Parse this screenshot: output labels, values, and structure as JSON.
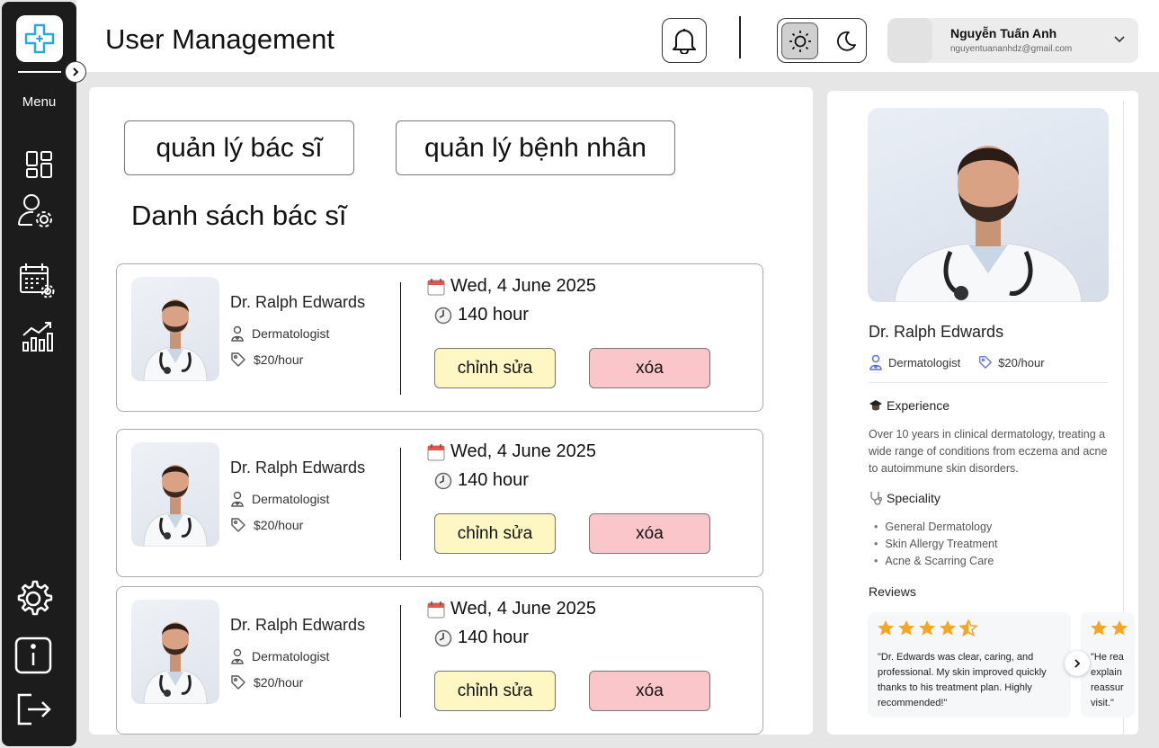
{
  "sidebar": {
    "menu_label": "Menu",
    "icons": [
      "dashboard-icon",
      "user-settings-icon",
      "calendar-settings-icon",
      "analytics-icon",
      "settings-icon",
      "info-icon",
      "logout-icon"
    ]
  },
  "header": {
    "title": "User Management",
    "user_name": "Nguyễn Tuấn Anh",
    "user_email": "nguyentuananhdz@gmail.com"
  },
  "tabs": [
    {
      "label": "quản lý bác sĩ"
    },
    {
      "label": "quản lý bệnh nhân"
    }
  ],
  "list": {
    "title": "Danh sách bác sĩ",
    "cards": [
      {
        "name": "Dr. Ralph Edwards",
        "specialty": "Dermatologist",
        "rate": "$20/hour",
        "date": "Wed, 4 June 2025",
        "hours": "140 hour",
        "edit_label": "chỉnh sửa",
        "delete_label": "xóa"
      },
      {
        "name": "Dr. Ralph Edwards",
        "specialty": "Dermatologist",
        "rate": "$20/hour",
        "date": "Wed, 4 June 2025",
        "hours": "140 hour",
        "edit_label": "chỉnh sửa",
        "delete_label": "xóa"
      },
      {
        "name": "Dr. Ralph Edwards",
        "specialty": "Dermatologist",
        "rate": "$20/hour",
        "date": "Wed, 4 June 2025",
        "hours": "140 hour",
        "edit_label": "chỉnh sửa",
        "delete_label": "xóa"
      }
    ]
  },
  "detail": {
    "name": "Dr. Ralph Edwards",
    "specialty": "Dermatologist",
    "rate": "$20/hour",
    "experience_title": "Experience",
    "experience_text": "Over 10 years in clinical dermatology, treating a wide range of conditions from eczema and acne to autoimmune skin disorders.",
    "speciality_title": "Speciality",
    "speciality_items": [
      "General Dermatology",
      "Skin Allergy Treatment",
      "Acne & Scarring Care"
    ],
    "reviews_title": "Reviews",
    "reviews": [
      {
        "stars": 4.5,
        "text": "\"Dr. Edwards was clear, caring, and professional. My skin improved quickly thanks to his treatment plan. Highly recommended!\""
      },
      {
        "stars": 2,
        "text": "\"He rea explain reassur visit.\""
      }
    ]
  },
  "colors": {
    "sidebar_bg": "#1c1c1c",
    "edit_button": "#fef6c3",
    "delete_button": "#fbc6c9",
    "accent_blue": "#29a8d8",
    "star": "#f5a623"
  }
}
